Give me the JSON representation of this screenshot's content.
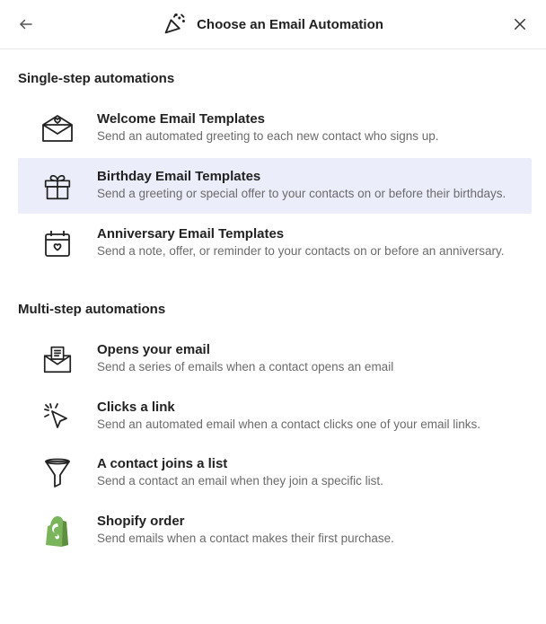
{
  "header": {
    "title": "Choose an Email Automation"
  },
  "sections": {
    "single": {
      "heading": "Single-step automations",
      "items": {
        "welcome": {
          "title": "Welcome Email Templates",
          "desc": "Send an automated greeting to each new contact who signs up."
        },
        "birthday": {
          "title": "Birthday Email Templates",
          "desc": "Send a greeting or special offer to your contacts on or before their birthdays."
        },
        "anniversary": {
          "title": "Anniversary Email Templates",
          "desc": "Send a note, offer, or reminder to your contacts on or before an anniversary."
        }
      }
    },
    "multi": {
      "heading": "Multi-step automations",
      "items": {
        "opens": {
          "title": "Opens your email",
          "desc": "Send a series of emails when a contact opens an email"
        },
        "clicks": {
          "title": "Clicks a link",
          "desc": "Send an automated email when a contact clicks one of your email links."
        },
        "joins": {
          "title": "A contact joins a list",
          "desc": "Send a contact an email when they join a specific list."
        },
        "shopify": {
          "title": "Shopify order",
          "desc": "Send emails when a contact makes their first purchase."
        }
      }
    }
  }
}
